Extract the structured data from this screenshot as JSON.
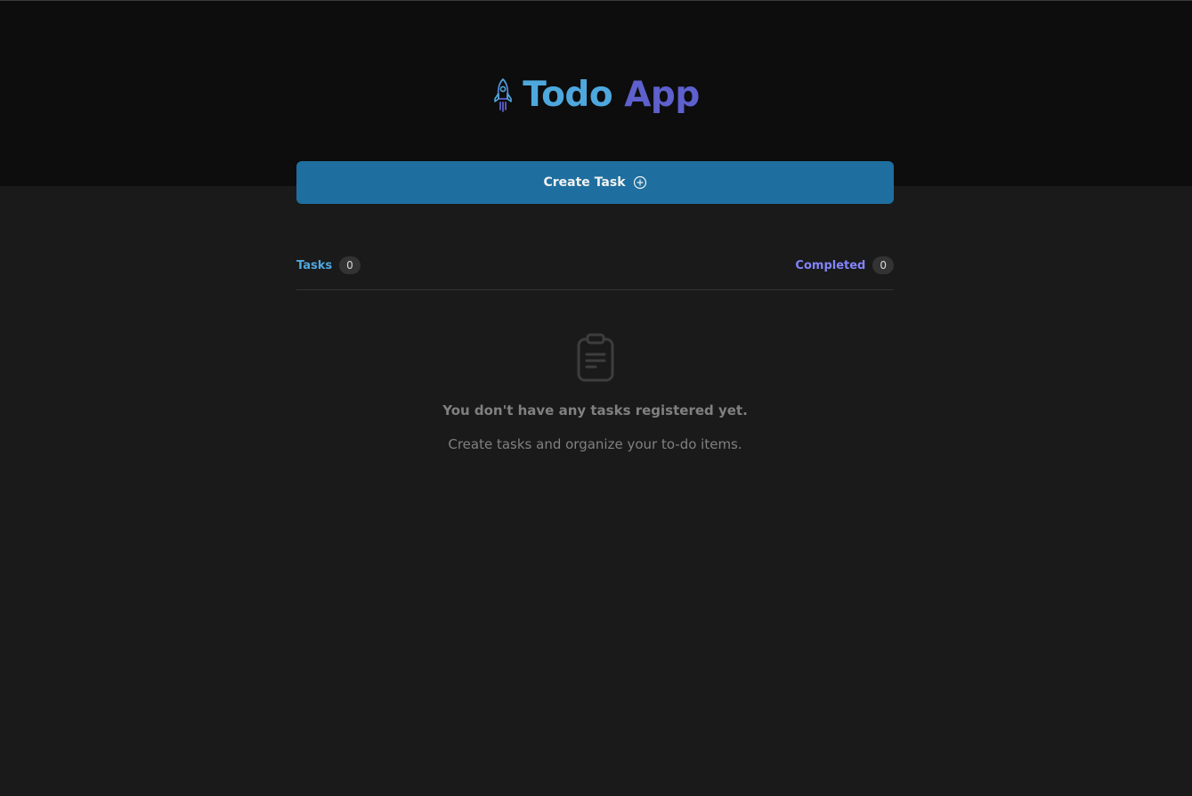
{
  "header": {
    "logo_icon": "rocket-icon",
    "title_part1": "Todo",
    "title_part2": "App",
    "colors": {
      "title_part1": "#4ea8de",
      "title_part2": "#5e60ce"
    }
  },
  "create_button": {
    "label": "Create Task",
    "icon": "plus-circle-icon",
    "color": "#1e6f9f"
  },
  "counters": {
    "tasks": {
      "label": "Tasks",
      "count": "0",
      "color": "#4ea8de"
    },
    "completed": {
      "label": "Completed",
      "count": "0",
      "color": "#8284fa"
    }
  },
  "empty_state": {
    "icon": "clipboard-icon",
    "title": "You don't have any tasks registered yet.",
    "subtitle": "Create tasks and organize your to-do items."
  }
}
